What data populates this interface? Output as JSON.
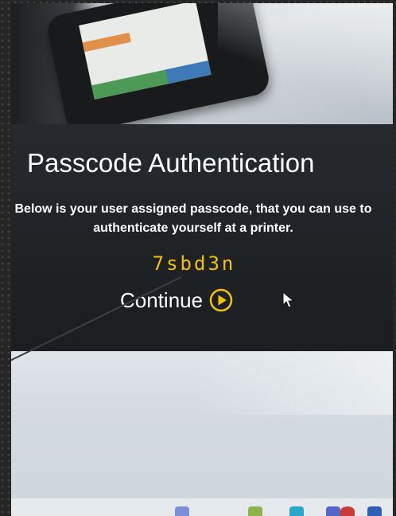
{
  "dialog": {
    "title": "Passcode Authentication",
    "description_line1": "Below is your user assigned passcode, that you can use to",
    "description_line2": "authenticate yourself at a printer.",
    "passcode": "7sbd3n",
    "continue_label": "Continue"
  },
  "colors": {
    "panel_background": "#23272a",
    "passcode": "#f2c400",
    "continue_icon": "#f2c400",
    "text": "#ffffff"
  },
  "icons": {
    "continue": "play-circle-icon",
    "pointer": "mouse-cursor-icon"
  }
}
